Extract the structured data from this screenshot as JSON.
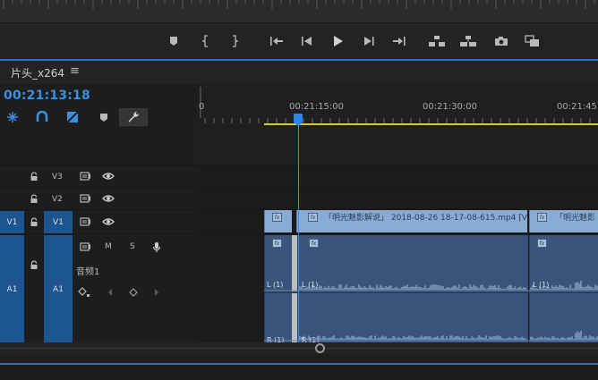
{
  "sequence": {
    "tab_title": "片头_x264",
    "timecode": "00:21:13:18"
  },
  "ruler": {
    "labels": [
      "0",
      "00:21:15:00",
      "00:21:30:00",
      "00:21:45:0"
    ]
  },
  "tracks": {
    "v3": {
      "label": "V3"
    },
    "v2": {
      "label": "V2"
    },
    "v1": {
      "label": "V1",
      "source_patch": "V1"
    },
    "a1": {
      "label": "A1",
      "source_patch": "A1",
      "name": "音频1",
      "mute": "M",
      "solo": "S"
    }
  },
  "clips": {
    "video_1_label": "「明光魅影解说」 2018-08-26 18-17-08-615.mp4 [V]",
    "video_2_label": "「明光魅影",
    "fx": "fx",
    "audio_left": "L (1)",
    "audio_right": "R (1)"
  },
  "colors": {
    "accent": "#2c6fc7",
    "timecode": "#3a8fe0",
    "video_clip": "#8aacd4",
    "audio_clip": "#38547a",
    "workarea": "#d9c930"
  }
}
